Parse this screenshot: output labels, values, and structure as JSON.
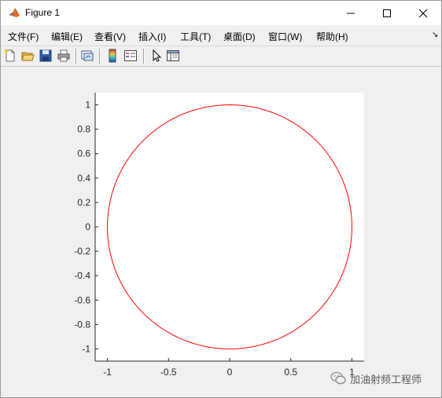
{
  "window": {
    "title": "Figure 1"
  },
  "menu": {
    "items": [
      {
        "label": "文件(F)"
      },
      {
        "label": "编辑(E)"
      },
      {
        "label": "查看(V)"
      },
      {
        "label": "插入(I)"
      },
      {
        "label": "工具(T)"
      },
      {
        "label": "桌面(D)"
      },
      {
        "label": "窗口(W)"
      },
      {
        "label": "帮助(H)"
      }
    ],
    "overflow_arrow": "↘"
  },
  "toolbar": {
    "icons": [
      "new-figure-icon",
      "open-file-icon",
      "save-icon",
      "print-icon",
      "link-plot-icon",
      "colorbar-icon",
      "legend-icon",
      "pointer-icon",
      "property-editor-icon"
    ]
  },
  "chart_data": {
    "type": "line",
    "series": [
      {
        "equation": "x = cos(t), y = sin(t)",
        "color": "#ff0000",
        "t_range": [
          0,
          6.2832
        ]
      }
    ],
    "xlim": [
      -1.1,
      1.1
    ],
    "ylim": [
      -1.1,
      1.1
    ],
    "xticks": [
      -1,
      -0.5,
      0,
      0.5,
      1
    ],
    "xtick_labels": [
      "-1",
      "-0.5",
      "0",
      "0.5",
      "1"
    ],
    "yticks": [
      1,
      0.8,
      0.6,
      0.4,
      0.2,
      0,
      -0.2,
      -0.4,
      -0.6,
      -0.8,
      -1
    ],
    "ytick_labels": [
      "1",
      "0.8",
      "0.6",
      "0.4",
      "0.2",
      "0",
      "-0.2",
      "-0.4",
      "-0.6",
      "-0.8",
      "-1"
    ],
    "grid": false,
    "title": "",
    "xlabel": "",
    "ylabel": ""
  },
  "watermark": {
    "text": "加油射频工程师"
  }
}
